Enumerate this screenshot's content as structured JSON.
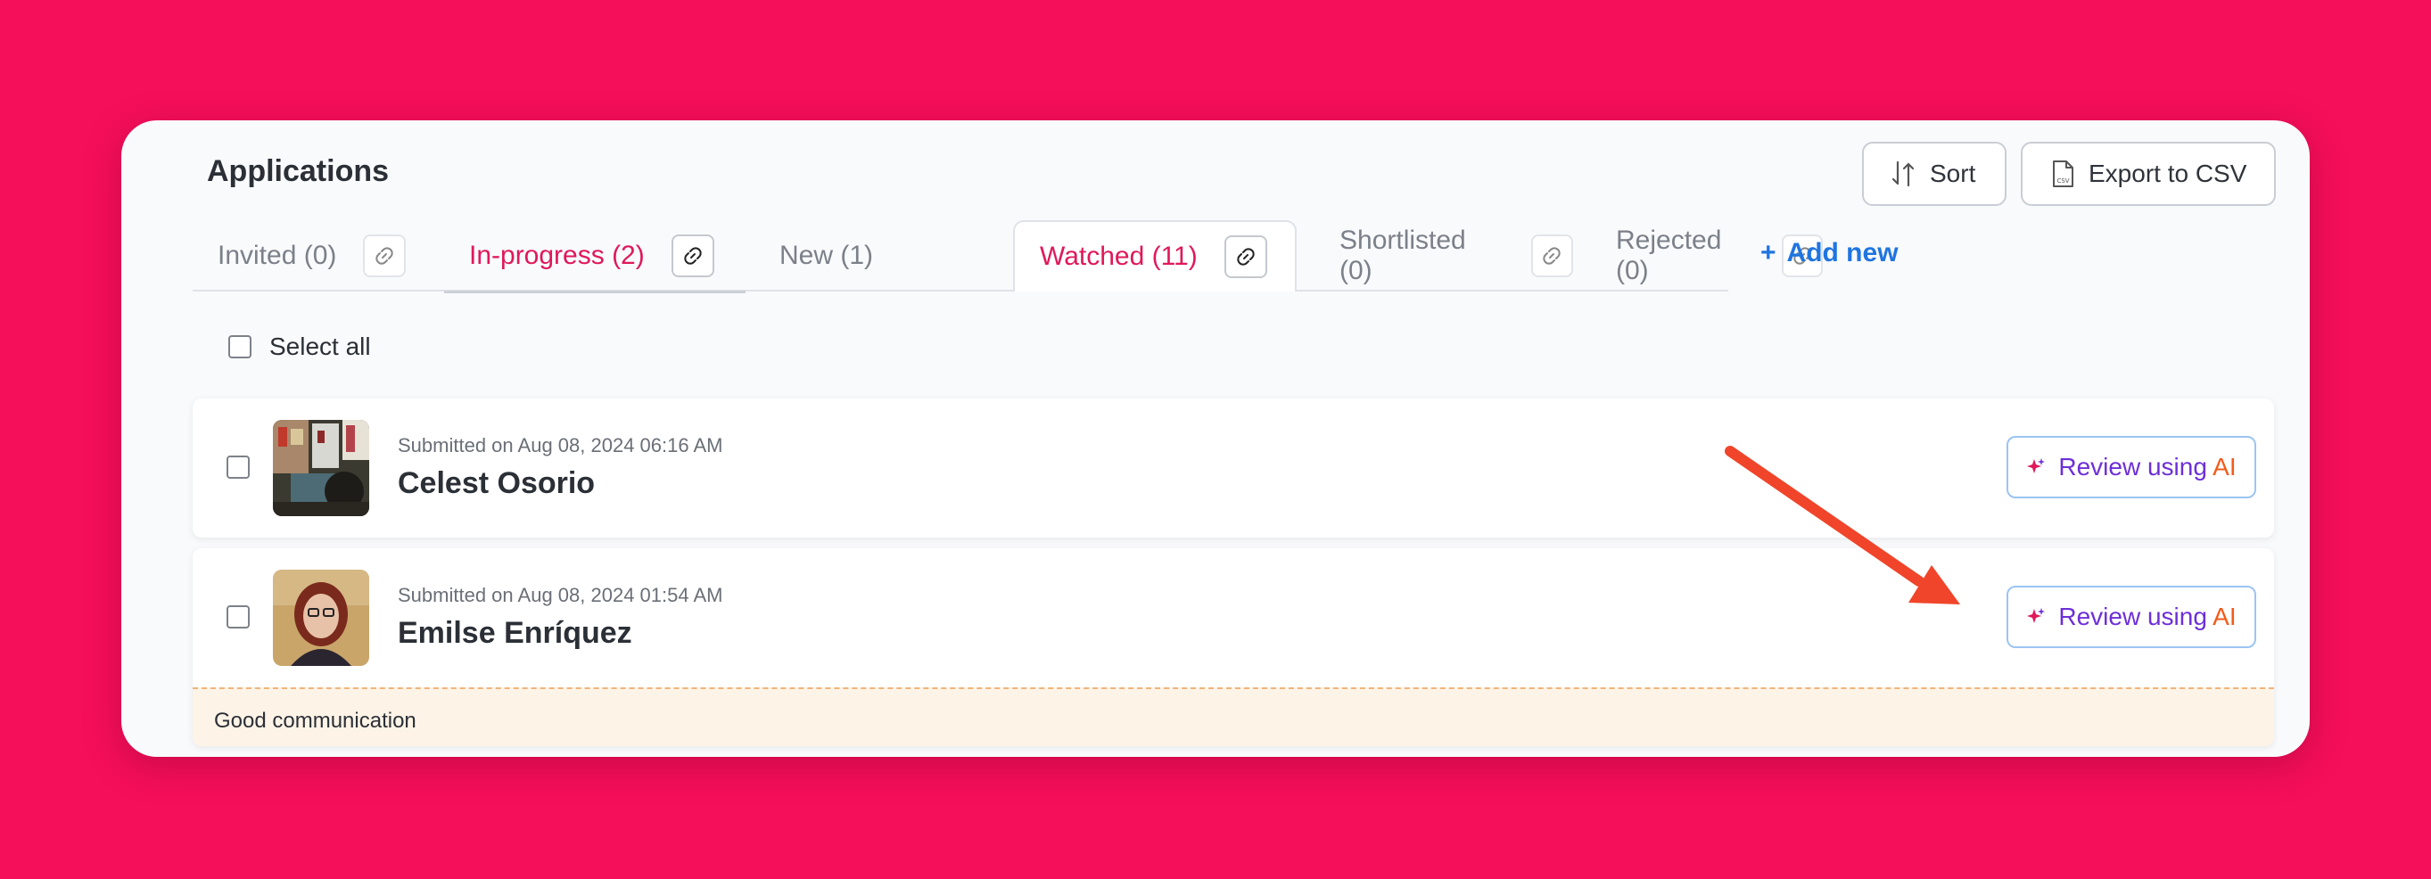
{
  "header": {
    "title": "Applications",
    "sort_label": "Sort",
    "export_label": "Export to CSV"
  },
  "tabs": [
    {
      "label": "Invited (0)",
      "state": "inactive"
    },
    {
      "label": "In-progress (2)",
      "state": "highlighted"
    },
    {
      "label": "New (1)",
      "state": "inactive"
    },
    {
      "label": "Watched (11)",
      "state": "selected"
    },
    {
      "label": "Shortlisted (0)",
      "state": "inactive"
    },
    {
      "label": "Rejected (0)",
      "state": "inactive"
    }
  ],
  "add_new_label": "Add new",
  "select_all_label": "Select all",
  "applications": [
    {
      "submitted": "Submitted on Aug 08, 2024 06:16 AM",
      "name": "Celest Osorio",
      "review_prefix": "Review using ",
      "review_ai": "AI"
    },
    {
      "submitted": "Submitted on Aug 08, 2024 01:54 AM",
      "name": "Emilse Enríquez",
      "review_prefix": "Review using ",
      "review_ai": "AI",
      "note": "Good communication"
    }
  ],
  "colors": {
    "background": "#f50e5a",
    "accent_red": "#e0185a",
    "link_blue": "#1f75e0",
    "annotation_arrow": "#f0452a"
  },
  "icons": [
    "sort-icon",
    "csv-file-icon",
    "link-icon",
    "plus-icon",
    "sparkle-icon",
    "annotation-arrow"
  ]
}
